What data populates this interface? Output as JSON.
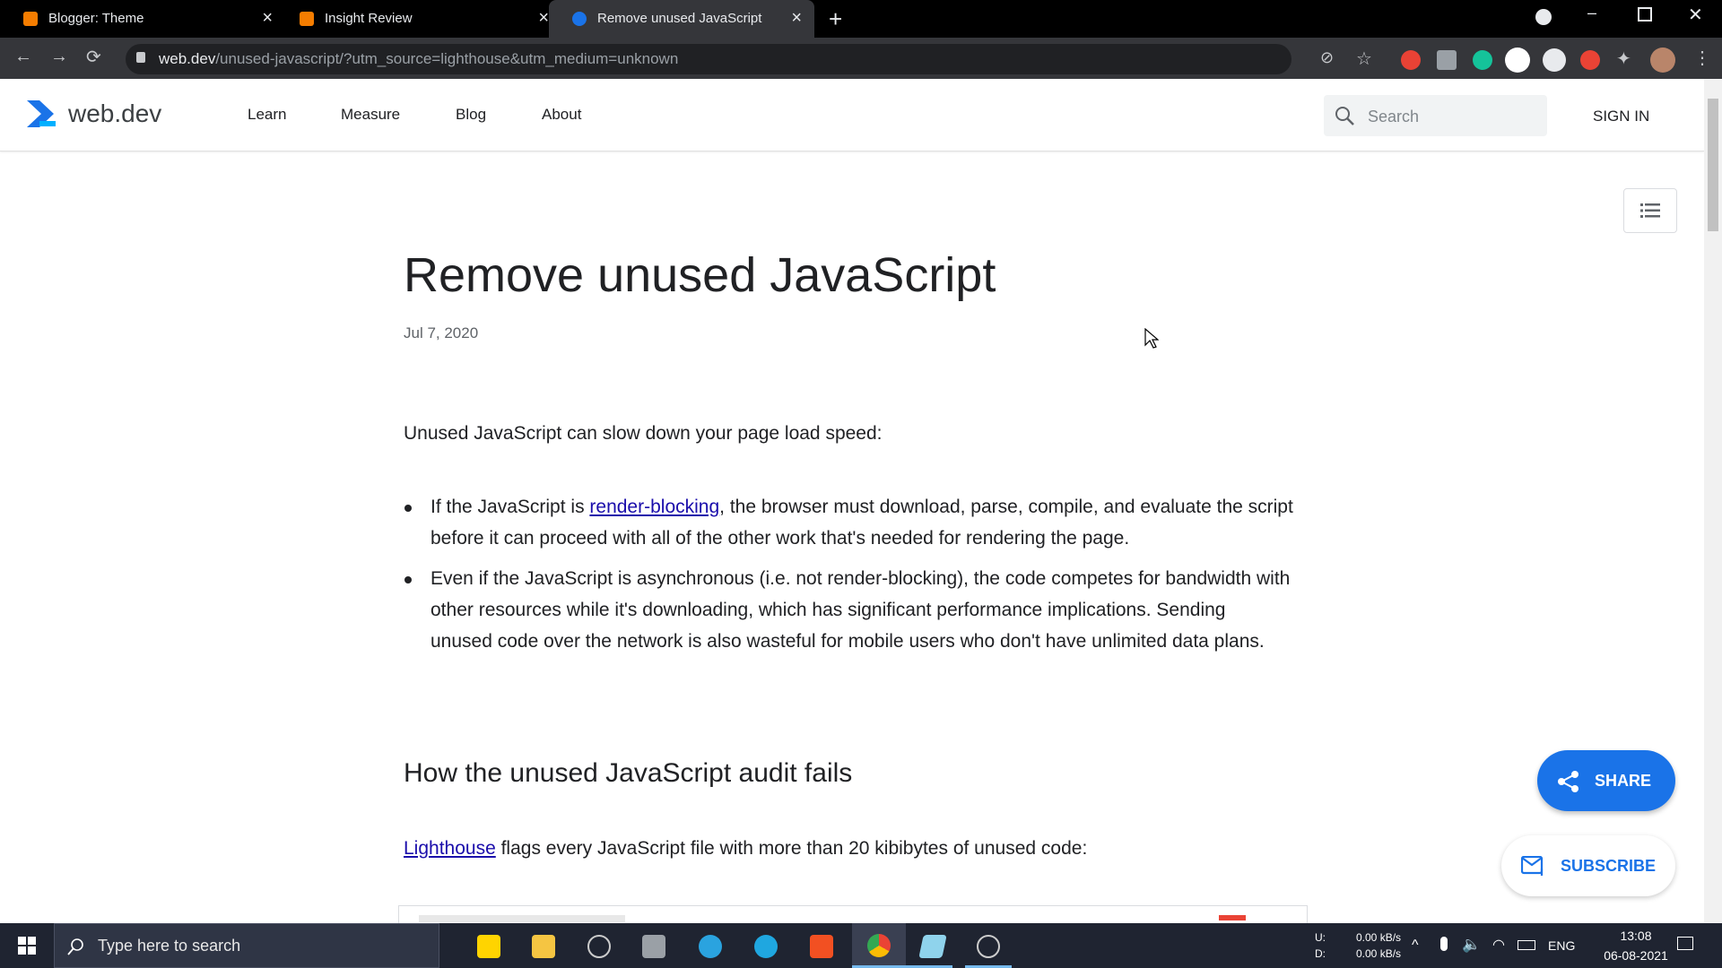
{
  "browser": {
    "tabs": [
      {
        "title": "Blogger: Theme",
        "favicon": "blogger-icon",
        "active": false
      },
      {
        "title": "Insight Review",
        "favicon": "blogger-icon",
        "active": false
      },
      {
        "title": "Remove unused JavaScript",
        "favicon": "webdev-icon",
        "active": true
      }
    ],
    "url_domain": "web.dev",
    "url_path": "/unused-javascript/?utm_source=lighthouse&utm_medium=unknown"
  },
  "site": {
    "logo_text": "web.dev",
    "nav": [
      "Learn",
      "Measure",
      "Blog",
      "About"
    ],
    "search_placeholder": "Search",
    "sign_in": "SIGN IN"
  },
  "article": {
    "title": "Remove unused JavaScript",
    "date": "Jul 7, 2020",
    "intro": "Unused JavaScript can slow down your page load speed:",
    "bullet1_pre": "If the JavaScript is ",
    "bullet1_link": "render-blocking",
    "bullet1_post": ", the browser must download, parse, compile, and evaluate the script before it can proceed with all of the other work that's needed for rendering the page.",
    "bullet2": "Even if the JavaScript is asynchronous (i.e. not render-blocking), the code competes for bandwidth with other resources while it's downloading, which has significant performance implications. Sending unused code over the network is also wasteful for mobile users who don't have unlimited data plans.",
    "h2": "How the unused JavaScript audit fails",
    "p2_link": "Lighthouse",
    "p2_post": " flags every JavaScript file with more than 20 kibibytes of unused code:"
  },
  "fab": {
    "share": "SHARE",
    "subscribe": "SUBSCRIBE"
  },
  "taskbar": {
    "search_placeholder": "Type here to search",
    "net_up_label": "U:",
    "net_down_label": "D:",
    "net_up": "0.00 kB/s",
    "net_down": "0.00 kB/s",
    "lang": "ENG",
    "time": "13:08",
    "date": "06-08-2021"
  },
  "colors": {
    "accent": "#1a73e8",
    "link": "#1a0dab",
    "tabbar": "#000000",
    "toolbar": "#35363a",
    "taskbar": "#1f2431"
  }
}
